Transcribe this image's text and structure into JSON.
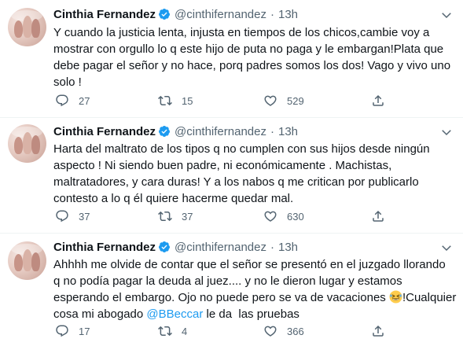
{
  "tweets": [
    {
      "name": "Cinthia Fernandez",
      "handle": "@cinthifernandez",
      "dot": "·",
      "time": "13h",
      "lines": [
        "Y cuando la justicia lenta, injusta en tiempos de los chicos,cambie voy a",
        "mostrar con orgullo lo q este hijo de puta no paga y le embargan!Plata que",
        "debe pagar el señor y no hace, porq padres somos los dos! Vago y vivo uno",
        "solo !"
      ],
      "replies": "27",
      "retweets": "15",
      "likes": "529"
    },
    {
      "name": "Cinthia Fernandez",
      "handle": "@cinthifernandez",
      "dot": "·",
      "time": "13h",
      "lines": [
        "Harta del maltrato de  los tipos q no cumplen con sus hijos desde ningún",
        "aspecto ! Ni siendo buen padre, ni económicamente . Machistas,",
        "maltratadores, y cara duras! Y a los nabos q me critican por publicarlo",
        "contesto a lo q él quiere hacerme quedar mal."
      ],
      "replies": "37",
      "retweets": "37",
      "likes": "630"
    },
    {
      "name": "Cinthia Fernandez",
      "handle": "@cinthifernandez",
      "dot": "·",
      "time": "13h",
      "lines": [
        "Ahhhh me olvide de contar que el señor se presentó en el juzgado llorando",
        "q no podía pagar la deuda al juez.... y no le dieron lugar y estamos",
        "esperando el embargo. Ojo no puede pero se va de vacaciones"
      ],
      "line3_after_emoji": "!Cualquier",
      "line4_prefix": "cosa mi abogado ",
      "mention": "@BBeccar",
      "line4_suffix": " le da  las pruebas",
      "emoji_icon": "rolling-on-floor-laughing-emoji",
      "replies": "17",
      "retweets": "4",
      "likes": "366"
    }
  ],
  "icons": {
    "verified": "verified-badge-icon",
    "caret": "chevron-down-icon",
    "reply": "reply-icon",
    "retweet": "retweet-icon",
    "like": "heart-icon",
    "share": "share-icon"
  },
  "colors": {
    "accent": "#1d9bf0",
    "text": "#0f1419",
    "secondary": "#536471",
    "divider": "#eff3f4"
  }
}
